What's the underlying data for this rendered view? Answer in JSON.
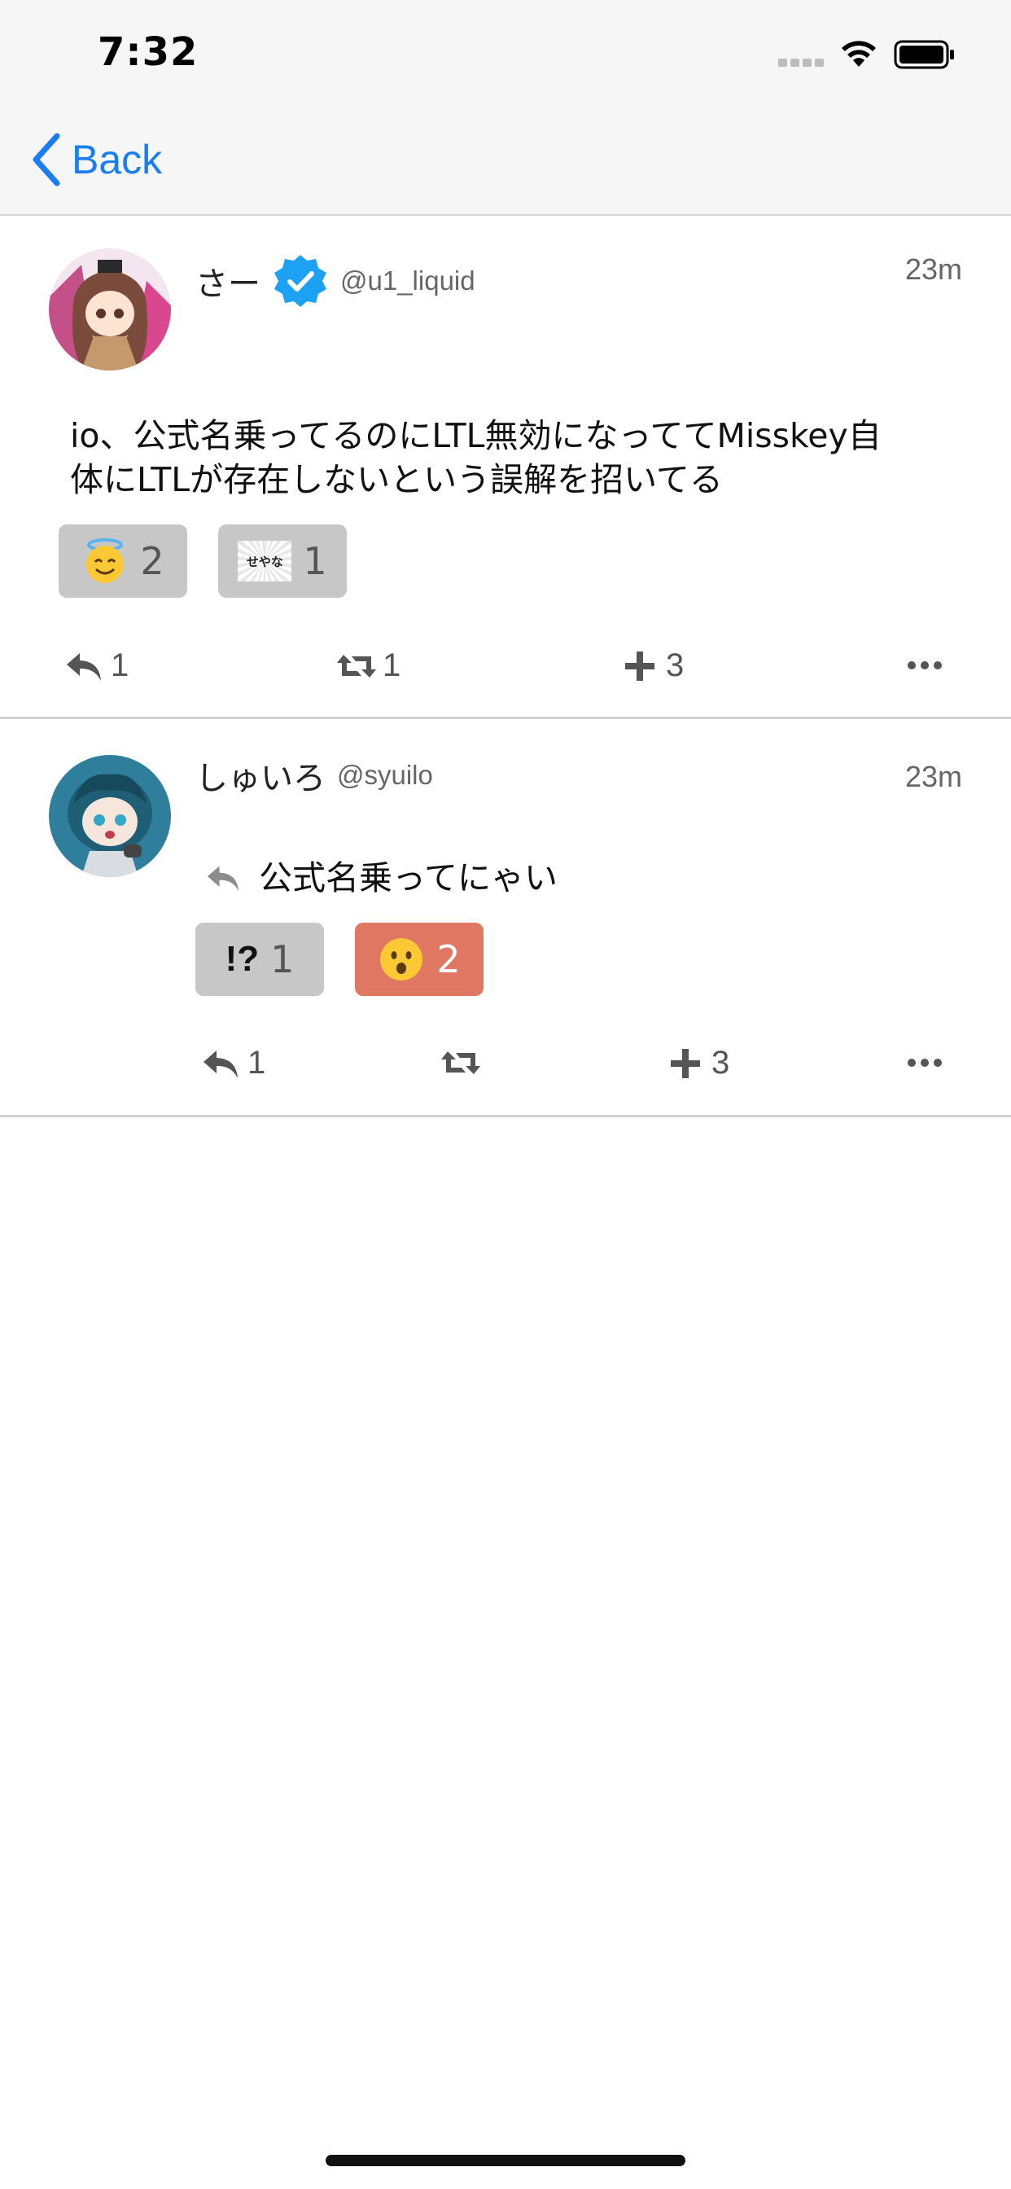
{
  "status_bar": {
    "time": "7:32"
  },
  "nav": {
    "back_label": "Back"
  },
  "notes": [
    {
      "display_name": "さー",
      "username": "@u1_liquid",
      "verified": true,
      "time": "23m",
      "text_line1": "io、公式名乗ってるのにLTL無効になっててMisskey自",
      "text_line2": "体にLTLが存在しないという誤解を招いてる",
      "reactions": [
        {
          "emoji": "smiling-face-with-halo",
          "count": "2"
        },
        {
          "emoji": "せやな",
          "count": "1"
        }
      ],
      "actions": {
        "reply_count": "1",
        "renote_count": "1",
        "react_count": "3"
      }
    },
    {
      "display_name": "しゅいろ",
      "username": "@syuilo",
      "time": "23m",
      "text": "公式名乗ってにゃい",
      "reactions": [
        {
          "emoji": "!?",
          "count": "1"
        },
        {
          "emoji": "hushed-face",
          "count": "2",
          "active": true
        }
      ],
      "actions": {
        "reply_count": "1",
        "renote_count": "",
        "react_count": "3"
      }
    }
  ],
  "colors": {
    "accent": "#1a7ef2",
    "active_reaction": "#e07763",
    "reaction_bg": "#c7c7c7",
    "verified": "#1da1f2"
  }
}
